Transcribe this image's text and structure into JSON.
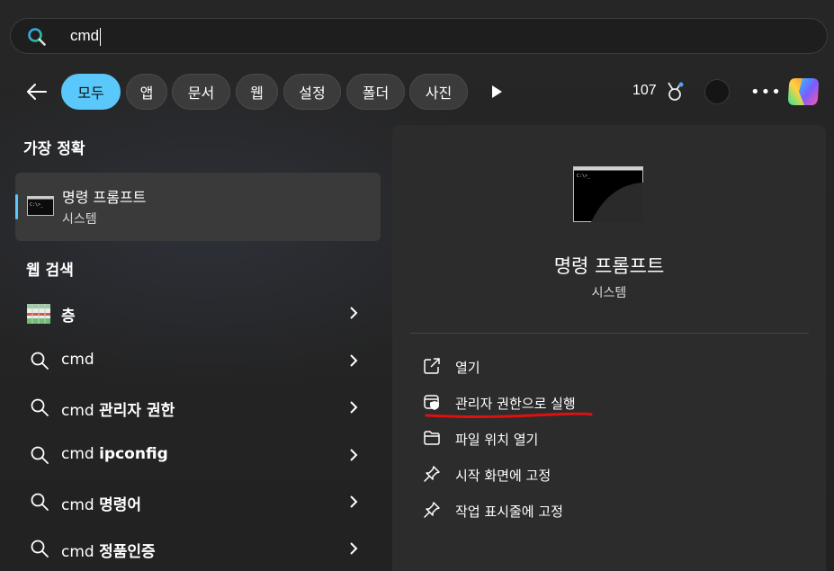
{
  "search": {
    "query": "cmd"
  },
  "filters": {
    "back_label": "뒤로",
    "chips": [
      {
        "label": "모두",
        "active": true
      },
      {
        "label": "앱",
        "active": false
      },
      {
        "label": "문서",
        "active": false
      },
      {
        "label": "웹",
        "active": false
      },
      {
        "label": "설정",
        "active": false
      },
      {
        "label": "폴더",
        "active": false
      },
      {
        "label": "사진",
        "active": false
      }
    ],
    "points": "107"
  },
  "best_match": {
    "section_title": "가장 정확",
    "app_name": "명령 프롬프트",
    "app_type": "시스템"
  },
  "web_search": {
    "section_title": "웹 검색",
    "results": [
      {
        "prefix": "",
        "bold": "층",
        "icon": "bing-thumbnail-icon"
      },
      {
        "prefix": "cmd",
        "bold": "",
        "icon": "search-icon"
      },
      {
        "prefix": "cmd ",
        "bold": "관리자 권한",
        "icon": "search-icon"
      },
      {
        "prefix": "cmd ",
        "bold": "ipconfig",
        "icon": "search-icon"
      },
      {
        "prefix": "cmd ",
        "bold": "명령어",
        "icon": "search-icon"
      },
      {
        "prefix": "cmd ",
        "bold": "정품인증",
        "icon": "search-icon"
      }
    ]
  },
  "details": {
    "title": "명령 프롬프트",
    "subtitle": "시스템",
    "actions": [
      {
        "label": "열기",
        "icon": "open-external-icon"
      },
      {
        "label": "관리자 권한으로 실행",
        "icon": "run-as-admin-shield-icon"
      },
      {
        "label": "파일 위치 열기",
        "icon": "folder-icon"
      },
      {
        "label": "시작 화면에 고정",
        "icon": "pin-icon"
      },
      {
        "label": "작업 표시줄에 고정",
        "icon": "pin-icon"
      }
    ]
  },
  "colors": {
    "accent": "#5ac8fa",
    "annotation_underline": "#e01010",
    "background": "#232323",
    "panel": "#2c2c2c"
  }
}
